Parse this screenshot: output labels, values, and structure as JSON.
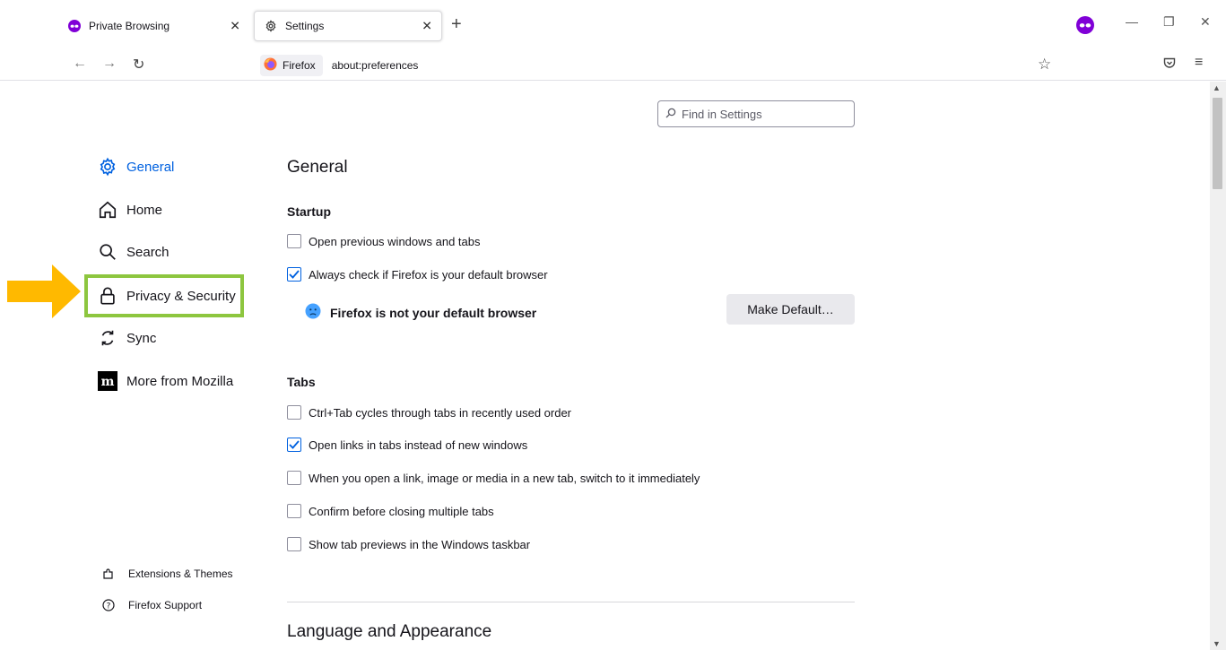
{
  "tabs": [
    {
      "label": "Private Browsing",
      "icon": "private-browsing-icon",
      "active": false
    },
    {
      "label": "Settings",
      "icon": "gear-icon",
      "active": true
    }
  ],
  "urlbar": {
    "identity_label": "Firefox",
    "url": "about:preferences"
  },
  "find": {
    "placeholder": "Find in Settings"
  },
  "sidebar": {
    "items": [
      {
        "label": "General",
        "icon": "gear-icon",
        "selected": true
      },
      {
        "label": "Home",
        "icon": "home-icon"
      },
      {
        "label": "Search",
        "icon": "search-icon"
      },
      {
        "label": "Privacy & Security",
        "icon": "lock-icon"
      },
      {
        "label": "Sync",
        "icon": "sync-icon"
      },
      {
        "label": "More from Mozilla",
        "icon": "mozilla-icon"
      }
    ],
    "footer": [
      {
        "label": "Extensions & Themes",
        "icon": "puzzle-icon"
      },
      {
        "label": "Firefox Support",
        "icon": "help-icon"
      }
    ]
  },
  "main": {
    "section_title": "General",
    "startup": {
      "heading": "Startup",
      "options": [
        {
          "label": "Open previous windows and tabs",
          "checked": false
        },
        {
          "label": "Always check if Firefox is your default browser",
          "checked": true
        }
      ],
      "not_default_text": "Firefox is not your default browser",
      "make_default_label": "Make Default…"
    },
    "tabs_section": {
      "heading": "Tabs",
      "options": [
        {
          "label": "Ctrl+Tab cycles through tabs in recently used order",
          "checked": false
        },
        {
          "label": "Open links in tabs instead of new windows",
          "checked": true
        },
        {
          "label": "When you open a link, image or media in a new tab, switch to it immediately",
          "checked": false
        },
        {
          "label": "Confirm before closing multiple tabs",
          "checked": false
        },
        {
          "label": "Show tab previews in the Windows taskbar",
          "checked": false
        }
      ]
    },
    "language_title": "Language and Appearance"
  },
  "colors": {
    "accent": "#0061e0",
    "highlight_box": "#8dc63f",
    "arrow": "#ffb900",
    "private_purple": "#8000d7"
  }
}
